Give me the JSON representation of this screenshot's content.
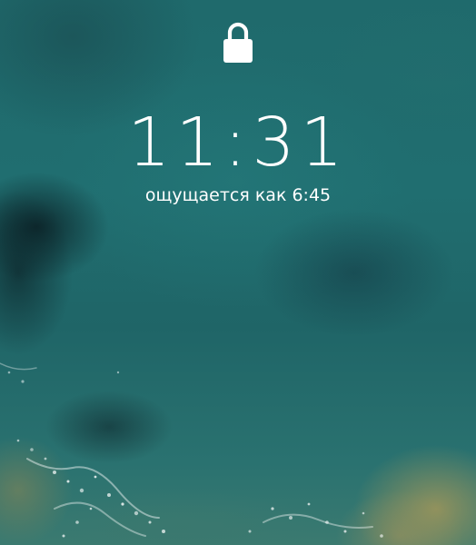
{
  "lockscreen": {
    "lock_icon": "lock-icon",
    "time": "11:31",
    "feels_like": "ощущается как 6:45"
  },
  "colors": {
    "text": "#ffffff",
    "water": "#1f6a6c",
    "sand": "#a0965a"
  }
}
